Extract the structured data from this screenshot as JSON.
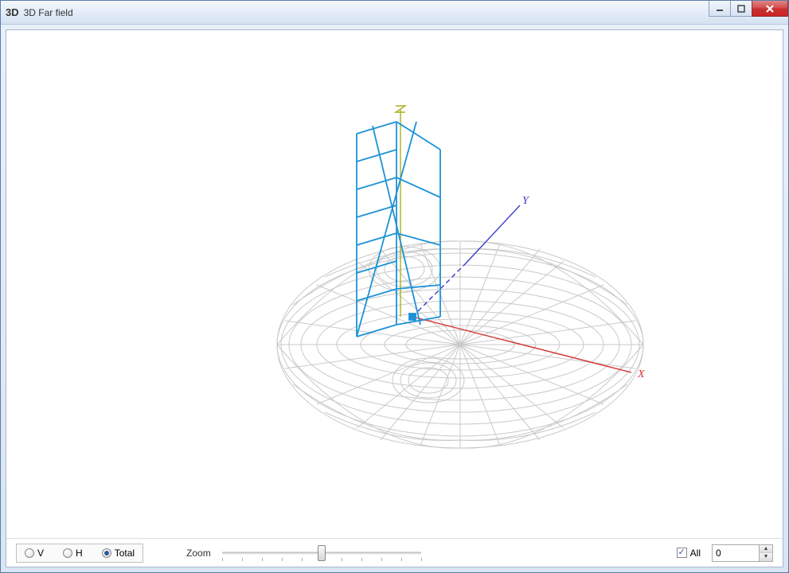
{
  "window": {
    "icon_text": "3D",
    "title": "3D Far field"
  },
  "axes": {
    "x": "X",
    "y": "Y",
    "z": "Z"
  },
  "controls": {
    "radios": {
      "v": "V",
      "h": "H",
      "total": "Total",
      "selected": "total"
    },
    "zoom_label": "Zoom",
    "slider": {
      "min": 0,
      "max": 10,
      "value": 5
    },
    "all_checkbox": {
      "label": "All",
      "checked": true
    },
    "spinner_value": "0"
  }
}
